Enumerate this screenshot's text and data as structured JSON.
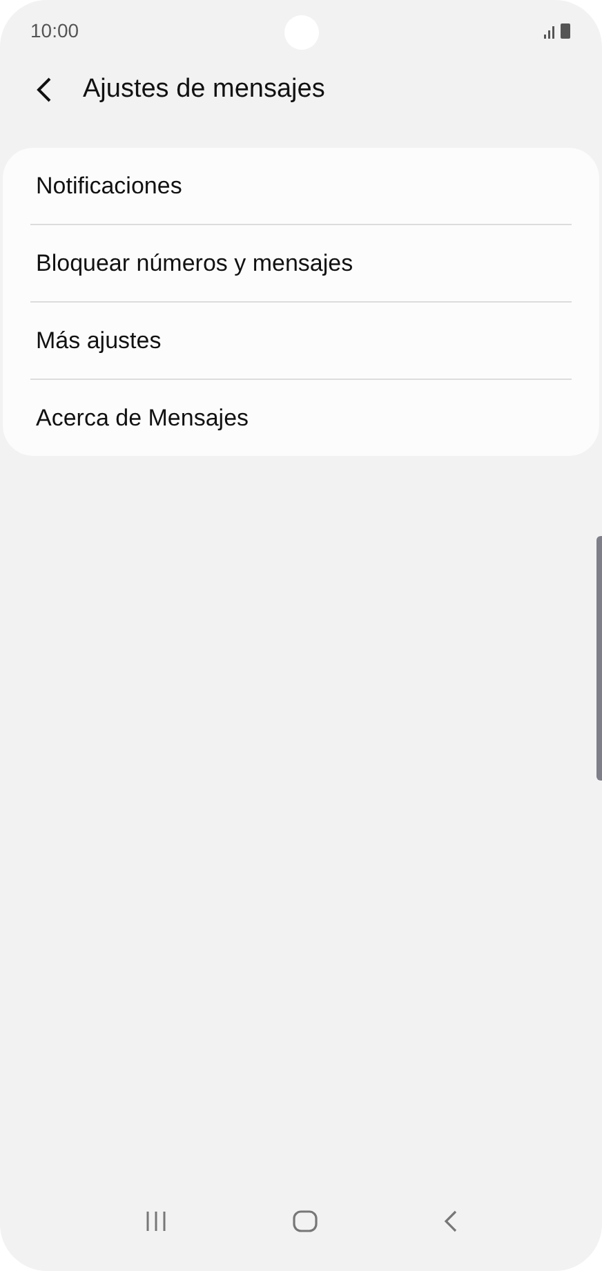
{
  "status_bar": {
    "time": "10:00"
  },
  "header": {
    "title": "Ajustes de mensajes"
  },
  "settings_items": [
    {
      "label": "Notificaciones"
    },
    {
      "label": "Bloquear números y mensajes"
    },
    {
      "label": "Más ajustes"
    },
    {
      "label": "Acerca de Mensajes"
    }
  ]
}
